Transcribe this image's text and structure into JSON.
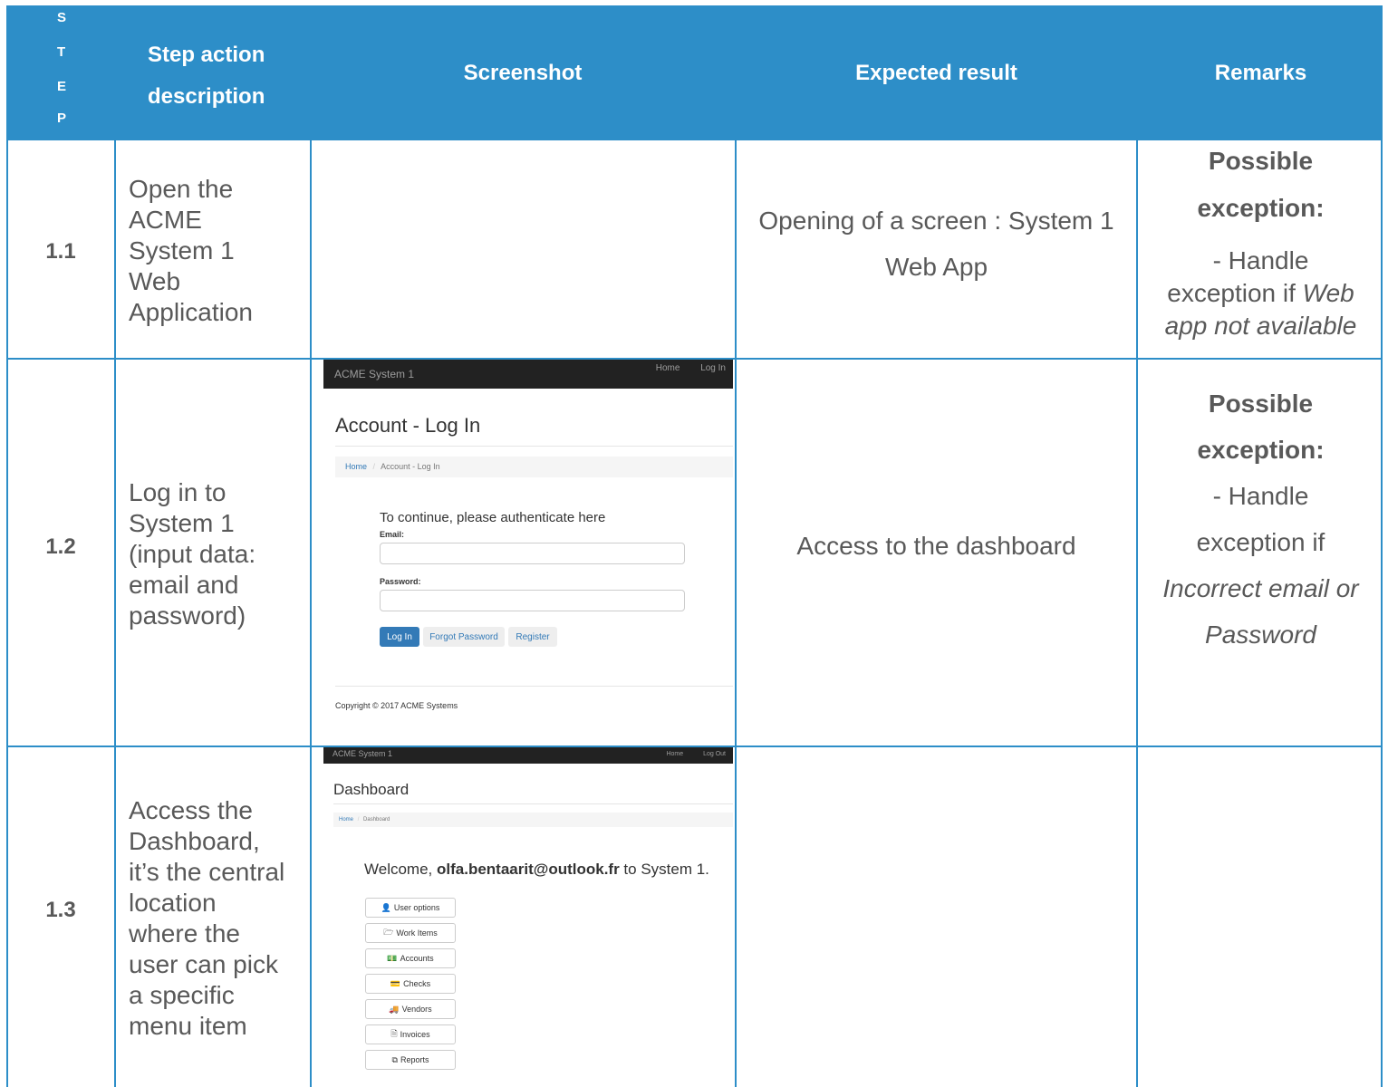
{
  "header": {
    "step_letters": [
      "S",
      "T",
      "E",
      "P"
    ],
    "step_action_line1": "Step action",
    "step_action_line2": "description",
    "screenshot": "Screenshot",
    "expected": "Expected result",
    "remarks": "Remarks"
  },
  "rows": [
    {
      "step": "1.1",
      "action": [
        "Open the",
        "ACME",
        "System 1",
        "Web",
        "Application"
      ],
      "expected": [
        "Opening of a screen : System 1",
        "Web App"
      ],
      "remarks": {
        "title1": "Possible",
        "title2": "exception:",
        "line1": "- Handle",
        "line2_plain": "exception if ",
        "line2_italic": "Web",
        "line3_italic": "app not available"
      }
    },
    {
      "step": "1.2",
      "action": [
        "Log in to",
        "System 1",
        "(input data:",
        "email and",
        "password)"
      ],
      "expected": [
        "Access to the dashboard"
      ],
      "remarks": {
        "title1": "Possible",
        "title2": "exception:",
        "line1": "-  Handle",
        "line2": "exception if",
        "line3_italic": "Incorrect email or",
        "line4_italic": "Password"
      },
      "screenshot": {
        "brand": "ACME System 1",
        "nav_home": "Home",
        "nav_login": "Log In",
        "title": "Account - Log In",
        "crumb_home": "Home",
        "crumb_sep": "/",
        "crumb_current": "Account - Log In",
        "prompt": "To continue, please authenticate here",
        "email_label": "Email:",
        "password_label": "Password:",
        "login_btn": "Log In",
        "forgot_btn": "Forgot Password",
        "register_btn": "Register",
        "copyright": "Copyright © 2017 ACME Systems"
      }
    },
    {
      "step": "1.3",
      "action": [
        "Access the",
        "Dashboard,",
        "it’s the central",
        "location",
        "where the",
        "user can pick",
        "a specific",
        "menu item"
      ],
      "screenshot": {
        "brand": "ACME System 1",
        "nav_home": "Home",
        "nav_logout": "Log Out",
        "title": "Dashboard",
        "crumb_home": "Home",
        "crumb_sep": "/",
        "crumb_current": "Dashboard",
        "welcome_prefix": "Welcome, ",
        "welcome_email": "olfa.bentaarit@outlook.fr",
        "welcome_suffix": " to System 1.",
        "menu": [
          {
            "icon": "user-icon",
            "glyph": "👤",
            "label": "User options"
          },
          {
            "icon": "folder-open-icon",
            "glyph": "🗁",
            "label": "Work Items"
          },
          {
            "icon": "money-icon",
            "glyph": "💵",
            "label": "Accounts"
          },
          {
            "icon": "credit-card-icon",
            "glyph": "💳",
            "label": "Checks"
          },
          {
            "icon": "truck-icon",
            "glyph": "🚚",
            "label": "Vendors"
          },
          {
            "icon": "file-icon",
            "glyph": "🗎",
            "label": "Invoices"
          },
          {
            "icon": "copy-icon",
            "glyph": "⧉",
            "label": "Reports"
          }
        ]
      }
    }
  ]
}
